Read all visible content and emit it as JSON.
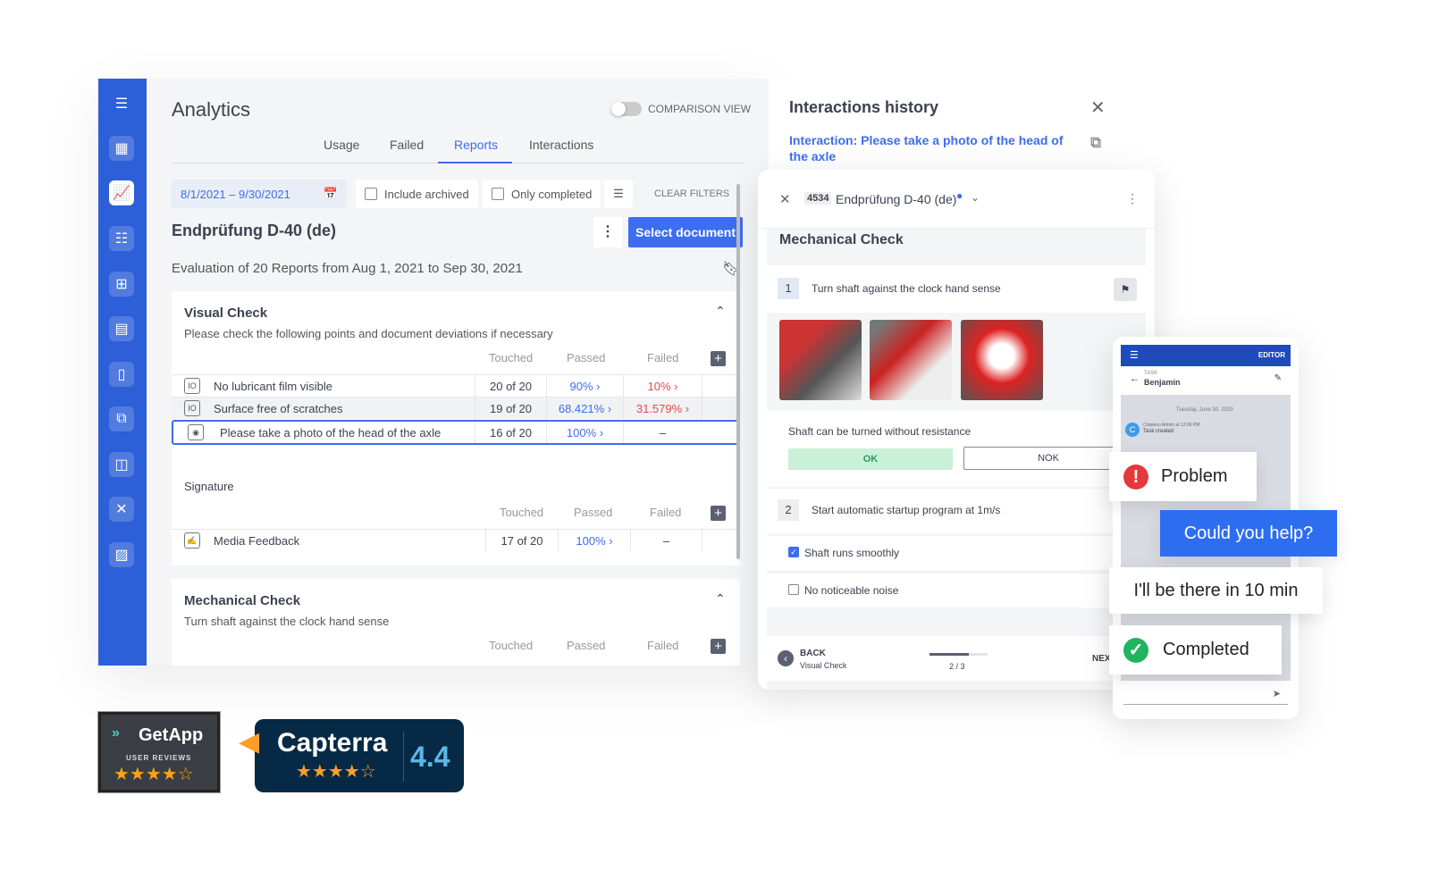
{
  "app": {
    "title": "Analytics",
    "comparison_label": "COMPARISON VIEW",
    "tabs": [
      {
        "label": "Usage"
      },
      {
        "label": "Failed"
      },
      {
        "label": "Reports"
      },
      {
        "label": "Interactions"
      }
    ],
    "filters": {
      "date_range": "8/1/2021 – 9/30/2021",
      "include_archived": "Include archived",
      "only_completed": "Only completed",
      "clear": "CLEAR FILTERS"
    },
    "document_title": "Endprüfung D-40 (de)",
    "select_document": "Select document",
    "evaluation": "Evaluation of 20 Reports from Aug 1, 2021 to Sep 30, 2021",
    "columns": {
      "touched": "Touched",
      "passed": "Passed",
      "failed": "Failed"
    },
    "visual_check": {
      "title": "Visual Check",
      "desc": "Please check the following points and document deviations if necessary",
      "rows": [
        {
          "label": "No lubricant film visible",
          "touched": "20 of 20",
          "passed": "90%",
          "failed": "10%"
        },
        {
          "label": "Surface free of scratches",
          "touched": "19 of 20",
          "passed": "68.421%",
          "failed": "31.579%"
        },
        {
          "label": "Please take a photo of the head of the axle",
          "touched": "16 of 20",
          "passed": "100%",
          "failed": "–"
        }
      ]
    },
    "signature": {
      "title": "Signature",
      "rows": [
        {
          "label": "Media Feedback",
          "touched": "17 of 20",
          "passed": "100%",
          "failed": "–"
        }
      ]
    },
    "mechanical_check": {
      "title": "Mechanical Check",
      "desc": "Turn shaft against the clock hand sense"
    }
  },
  "history": {
    "title": "Interactions history",
    "link": "Interaction: Please take a photo of the head of the axle"
  },
  "checklist": {
    "doc_id": "4534",
    "doc_name": "Endprüfung D-40 (de)",
    "section": "Mechanical Check",
    "step1": {
      "num": "1",
      "label": "Turn shaft against the clock hand sense"
    },
    "question": "Shaft can be turned without resistance",
    "ok": "OK",
    "nok": "NOK",
    "step2": {
      "num": "2",
      "label": "Start automatic startup program at 1m/s"
    },
    "check1": "Shaft runs smoothly",
    "check2": "No noticeable noise",
    "back": "BACK",
    "back_sub": "Visual Check",
    "progress": "2 / 3",
    "progress_fraction": 0.67,
    "next": "NEX"
  },
  "phone": {
    "mode": "EDITOR",
    "task_label": "TASK",
    "task_name": "Benjamin",
    "date": "Tuesday, June 30, 2020",
    "avatar": "C",
    "author": "Ciopienu Admin at 12:06 PM",
    "event": "Task created"
  },
  "chat": {
    "problem": "Problem",
    "help": "Could you help?",
    "reply": "I'll be there in 10 min",
    "completed": "Completed"
  },
  "badges": {
    "getapp": "GetApp",
    "getapp_sub": "USER REVIEWS",
    "capterra": "Capterra",
    "capterra_score": "4.4"
  },
  "colors": {
    "primary": "#2d5fd8",
    "accent": "#3d6df0",
    "fail": "#e5484d",
    "ok": "#c9f0d8"
  }
}
